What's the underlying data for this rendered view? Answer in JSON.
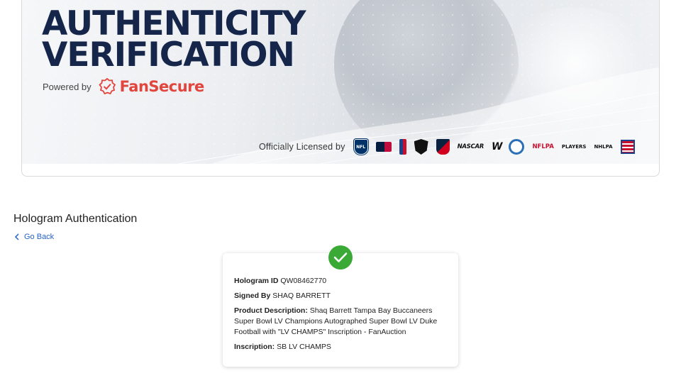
{
  "banner": {
    "title_line1": "AUTHENTICITY",
    "title_line2": "VERIFICATION",
    "powered_by": "Powered by",
    "brand": "FanSecure",
    "licensed_label": "Officially Licensed by",
    "leagues": [
      "NFL",
      "MLB",
      "NBA",
      "NHL",
      "MLS",
      "NASCAR",
      "WWE",
      "USA Hockey",
      "NFLPA",
      "PLAYERS",
      "NHLPA",
      "Hall of Fame"
    ],
    "nascar_text": "NASCAR",
    "wwe_text": "W",
    "nflpa_text": "NFLPA",
    "players_text": "PLAYERS",
    "nhlpa_text": "NHLPA"
  },
  "page": {
    "title": "Hologram Authentication",
    "back_label": "Go Back"
  },
  "record": {
    "hologram_label": "Hologram ID",
    "hologram_value": "QW08462770",
    "signed_label": "Signed By",
    "signed_value": "SHAQ BARRETT",
    "product_label": "Product Description:",
    "product_value": "Shaq Barrett Tampa Bay Buccaneers Super Bowl LV Champions Autographed Super Bowl LV Duke Football with \"LV CHAMPS\" Inscription - FanAuction",
    "inscription_label": "Inscription:",
    "inscription_value": "SB LV CHAMPS"
  },
  "colors": {
    "title_navy": "#15264a",
    "brand_red": "#e2453b",
    "link_blue": "#2563c9",
    "success_green": "#3aa935"
  }
}
